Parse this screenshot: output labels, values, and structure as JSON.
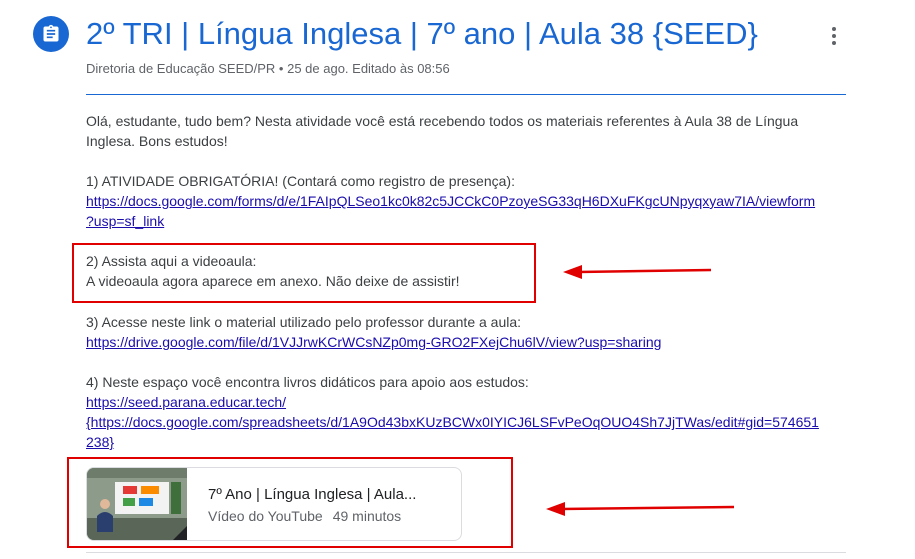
{
  "post": {
    "title": "2º TRI | Língua Inglesa | 7º ano | Aula 38 {SEED}",
    "author": "Diretoria de Educação SEED/PR",
    "meta_rest": " • 25 de ago. Editado às 08:56"
  },
  "body": {
    "intro_line1": "Olá, estudante, tudo bem? Nesta atividade você está recebendo todos os materiais referentes à Aula 38 de Língua",
    "intro_line2": "Inglesa. Bons estudos!",
    "item1_text": "1) ATIVIDADE OBRIGATÓRIA! (Contará como registro de presença):",
    "item1_link_line1": "https://docs.google.com/forms/d/e/1FAIpQLSeo1kc0k82c5JCCkC0PzoyeSG33qH6DXuFKgcUNpyqxyaw7IA/viewform",
    "item1_link_line2": "?usp=sf_link",
    "item2_line1": "2) Assista aqui a videoaula:",
    "item2_line2": "A videoaula agora aparece em anexo. Não deixe de assistir!",
    "item3_text": "3) Acesse neste link o material utilizado pelo professor durante a aula:",
    "item3_link": "https://drive.google.com/file/d/1VJJrwKCrWCsNZp0mg-GRO2FXejChu6lV/view?usp=sharing",
    "item4_text": "4) Neste espaço você encontra livros didáticos para apoio aos estudos:",
    "item4_link1": "https://seed.parana.educar.tech/",
    "item4_link2_line1": "{https://docs.google.com/spreadsheets/d/1A9Od43bxKUzBCWx0IYICJ6LSFvPeOqOUO4Sh7JjTWas/edit#gid=574651",
    "item4_link2_line2": "238}"
  },
  "attachment": {
    "title": "7º Ano | Língua Inglesa | Aula...",
    "source": "Vídeo do YouTube",
    "duration": "49 minutos"
  },
  "colors": {
    "accent": "#1967d2",
    "link": "#1a0dab",
    "annotation": "#e00000"
  },
  "icons": [
    "assignment-icon",
    "more-vert-icon"
  ]
}
